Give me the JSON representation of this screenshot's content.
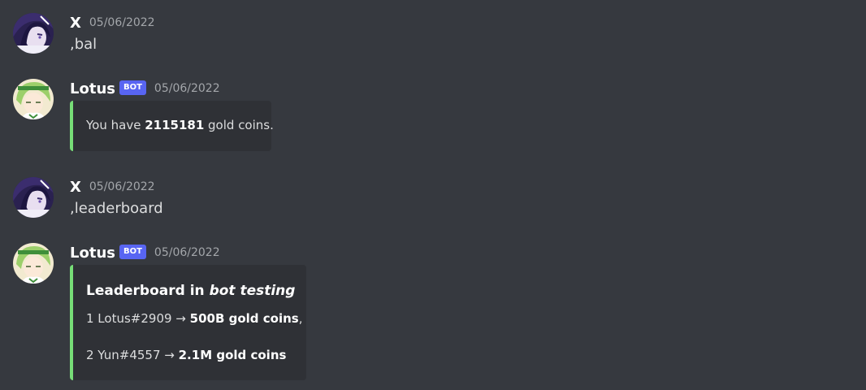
{
  "messages": [
    {
      "username": "X",
      "timestamp": "05/06/2022",
      "content": ",bal"
    },
    {
      "username": "Lotus",
      "bot_tag": "BOT",
      "timestamp": "05/06/2022",
      "embed": {
        "text_prefix": "You have ",
        "text_bold": "2115181",
        "text_suffix": " gold coins."
      }
    },
    {
      "username": "X",
      "timestamp": "05/06/2022",
      "content": ",leaderboard"
    },
    {
      "username": "Lotus",
      "bot_tag": "BOT",
      "timestamp": "05/06/2022",
      "embed": {
        "title_prefix": "Leaderboard in ",
        "title_italic": "bot testing",
        "rows": [
          {
            "prefix": "1 Lotus#2909 → ",
            "bold": "500B gold coins",
            "suffix": ","
          },
          {
            "prefix": "2 Yun#4557 → ",
            "bold": "2.1M gold coins",
            "suffix": ""
          }
        ]
      }
    }
  ],
  "colors": {
    "background": "#36393f",
    "embed_background": "#2f3136",
    "embed_accent": "#77dd77",
    "bot_tag": "#5865f2"
  },
  "icons": {
    "user_avatar": "anime-purple-hair-avatar",
    "bot_avatar": "anime-green-hair-avatar"
  }
}
